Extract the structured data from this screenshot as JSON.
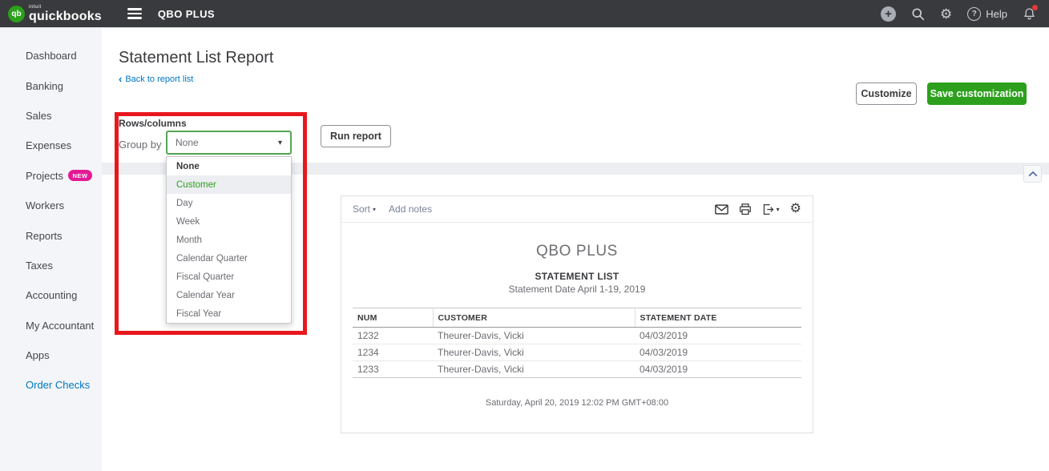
{
  "topbar": {
    "logo_text": "qb",
    "brand_intuit": "intuit",
    "brand_name": "quickbooks",
    "company": "QBO PLUS",
    "help_label": "Help",
    "icons": [
      "plus-icon",
      "search-icon",
      "gear-icon",
      "help-icon",
      "notifications-bell-icon"
    ]
  },
  "sidebar": {
    "items": [
      {
        "label": "Dashboard"
      },
      {
        "label": "Banking"
      },
      {
        "label": "Sales"
      },
      {
        "label": "Expenses"
      },
      {
        "label": "Projects",
        "badge": "NEW"
      },
      {
        "label": "Workers"
      },
      {
        "label": "Reports"
      },
      {
        "label": "Taxes"
      },
      {
        "label": "Accounting"
      },
      {
        "label": "My Accountant"
      },
      {
        "label": "Apps"
      },
      {
        "label": "Order Checks"
      }
    ]
  },
  "header": {
    "title": "Statement List Report",
    "back_link": "Back to report list",
    "customize_label": "Customize",
    "save_customization_label": "Save customization"
  },
  "filters": {
    "section_label": "Rows/columns",
    "group_by_label": "Group by",
    "selected_value": "None",
    "run_report_label": "Run report",
    "options": [
      "None",
      "Customer",
      "Day",
      "Week",
      "Month",
      "Calendar Quarter",
      "Fiscal Quarter",
      "Calendar Year",
      "Fiscal Year"
    ],
    "highlighted_option": "Customer"
  },
  "report": {
    "toolbar": {
      "sort_label": "Sort",
      "add_notes_label": "Add notes",
      "icons": [
        "email-icon",
        "print-icon",
        "export-icon",
        "gear-icon"
      ]
    },
    "company": "QBO PLUS",
    "title": "STATEMENT LIST",
    "subtitle": "Statement Date April 1-19, 2019",
    "table": {
      "columns": [
        "NUM",
        "CUSTOMER",
        "STATEMENT DATE"
      ],
      "rows": [
        [
          "1232",
          "Theurer-Davis, Vicki",
          "04/03/2019"
        ],
        [
          "1234",
          "Theurer-Davis, Vicki",
          "04/03/2019"
        ],
        [
          "1233",
          "Theurer-Davis, Vicki",
          "04/03/2019"
        ]
      ]
    },
    "footer": "Saturday, April 20, 2019  12:02 PM GMT+08:00"
  },
  "colors": {
    "accent_green": "#2ca01c",
    "link_blue": "#0077c5",
    "topbar_bg": "#393a3d",
    "highlight_red": "#e8171d",
    "badge_pink": "#e31a96"
  }
}
